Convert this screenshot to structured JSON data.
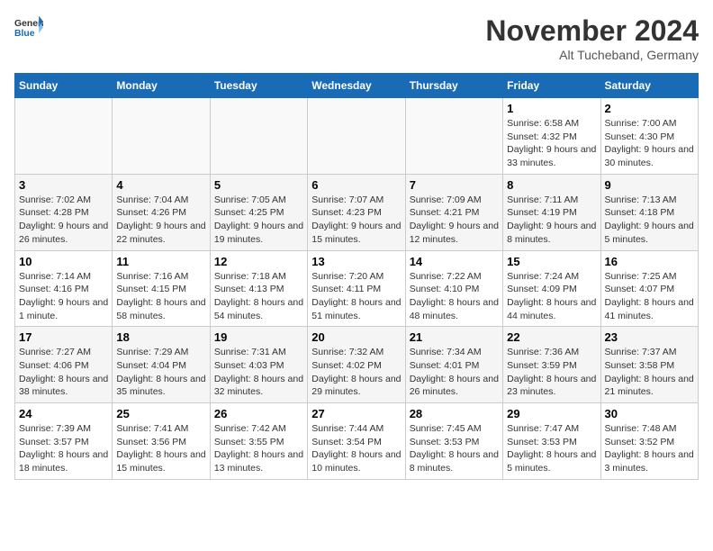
{
  "header": {
    "logo_general": "General",
    "logo_blue": "Blue",
    "month_title": "November 2024",
    "location": "Alt Tucheband, Germany"
  },
  "weekdays": [
    "Sunday",
    "Monday",
    "Tuesday",
    "Wednesday",
    "Thursday",
    "Friday",
    "Saturday"
  ],
  "weeks": [
    [
      {
        "day": "",
        "info": ""
      },
      {
        "day": "",
        "info": ""
      },
      {
        "day": "",
        "info": ""
      },
      {
        "day": "",
        "info": ""
      },
      {
        "day": "",
        "info": ""
      },
      {
        "day": "1",
        "info": "Sunrise: 6:58 AM\nSunset: 4:32 PM\nDaylight: 9 hours and 33 minutes."
      },
      {
        "day": "2",
        "info": "Sunrise: 7:00 AM\nSunset: 4:30 PM\nDaylight: 9 hours and 30 minutes."
      }
    ],
    [
      {
        "day": "3",
        "info": "Sunrise: 7:02 AM\nSunset: 4:28 PM\nDaylight: 9 hours and 26 minutes."
      },
      {
        "day": "4",
        "info": "Sunrise: 7:04 AM\nSunset: 4:26 PM\nDaylight: 9 hours and 22 minutes."
      },
      {
        "day": "5",
        "info": "Sunrise: 7:05 AM\nSunset: 4:25 PM\nDaylight: 9 hours and 19 minutes."
      },
      {
        "day": "6",
        "info": "Sunrise: 7:07 AM\nSunset: 4:23 PM\nDaylight: 9 hours and 15 minutes."
      },
      {
        "day": "7",
        "info": "Sunrise: 7:09 AM\nSunset: 4:21 PM\nDaylight: 9 hours and 12 minutes."
      },
      {
        "day": "8",
        "info": "Sunrise: 7:11 AM\nSunset: 4:19 PM\nDaylight: 9 hours and 8 minutes."
      },
      {
        "day": "9",
        "info": "Sunrise: 7:13 AM\nSunset: 4:18 PM\nDaylight: 9 hours and 5 minutes."
      }
    ],
    [
      {
        "day": "10",
        "info": "Sunrise: 7:14 AM\nSunset: 4:16 PM\nDaylight: 9 hours and 1 minute."
      },
      {
        "day": "11",
        "info": "Sunrise: 7:16 AM\nSunset: 4:15 PM\nDaylight: 8 hours and 58 minutes."
      },
      {
        "day": "12",
        "info": "Sunrise: 7:18 AM\nSunset: 4:13 PM\nDaylight: 8 hours and 54 minutes."
      },
      {
        "day": "13",
        "info": "Sunrise: 7:20 AM\nSunset: 4:11 PM\nDaylight: 8 hours and 51 minutes."
      },
      {
        "day": "14",
        "info": "Sunrise: 7:22 AM\nSunset: 4:10 PM\nDaylight: 8 hours and 48 minutes."
      },
      {
        "day": "15",
        "info": "Sunrise: 7:24 AM\nSunset: 4:09 PM\nDaylight: 8 hours and 44 minutes."
      },
      {
        "day": "16",
        "info": "Sunrise: 7:25 AM\nSunset: 4:07 PM\nDaylight: 8 hours and 41 minutes."
      }
    ],
    [
      {
        "day": "17",
        "info": "Sunrise: 7:27 AM\nSunset: 4:06 PM\nDaylight: 8 hours and 38 minutes."
      },
      {
        "day": "18",
        "info": "Sunrise: 7:29 AM\nSunset: 4:04 PM\nDaylight: 8 hours and 35 minutes."
      },
      {
        "day": "19",
        "info": "Sunrise: 7:31 AM\nSunset: 4:03 PM\nDaylight: 8 hours and 32 minutes."
      },
      {
        "day": "20",
        "info": "Sunrise: 7:32 AM\nSunset: 4:02 PM\nDaylight: 8 hours and 29 minutes."
      },
      {
        "day": "21",
        "info": "Sunrise: 7:34 AM\nSunset: 4:01 PM\nDaylight: 8 hours and 26 minutes."
      },
      {
        "day": "22",
        "info": "Sunrise: 7:36 AM\nSunset: 3:59 PM\nDaylight: 8 hours and 23 minutes."
      },
      {
        "day": "23",
        "info": "Sunrise: 7:37 AM\nSunset: 3:58 PM\nDaylight: 8 hours and 21 minutes."
      }
    ],
    [
      {
        "day": "24",
        "info": "Sunrise: 7:39 AM\nSunset: 3:57 PM\nDaylight: 8 hours and 18 minutes."
      },
      {
        "day": "25",
        "info": "Sunrise: 7:41 AM\nSunset: 3:56 PM\nDaylight: 8 hours and 15 minutes."
      },
      {
        "day": "26",
        "info": "Sunrise: 7:42 AM\nSunset: 3:55 PM\nDaylight: 8 hours and 13 minutes."
      },
      {
        "day": "27",
        "info": "Sunrise: 7:44 AM\nSunset: 3:54 PM\nDaylight: 8 hours and 10 minutes."
      },
      {
        "day": "28",
        "info": "Sunrise: 7:45 AM\nSunset: 3:53 PM\nDaylight: 8 hours and 8 minutes."
      },
      {
        "day": "29",
        "info": "Sunrise: 7:47 AM\nSunset: 3:53 PM\nDaylight: 8 hours and 5 minutes."
      },
      {
        "day": "30",
        "info": "Sunrise: 7:48 AM\nSunset: 3:52 PM\nDaylight: 8 hours and 3 minutes."
      }
    ]
  ]
}
